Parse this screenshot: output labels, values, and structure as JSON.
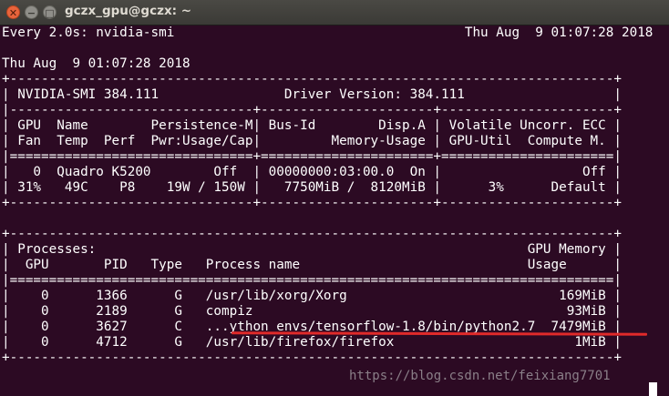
{
  "window": {
    "title": "gczx_gpu@gczx: ~",
    "close_glyph": "✕",
    "minimize_glyph": "−",
    "maximize_glyph": "□"
  },
  "terminal": {
    "lines": [
      "Every 2.0s: nvidia-smi                                     Thu Aug  9 01:07:28 2018",
      "",
      "Thu Aug  9 01:07:28 2018",
      "+-----------------------------------------------------------------------------+",
      "| NVIDIA-SMI 384.111                Driver Version: 384.111                   |",
      "|-------------------------------+----------------------+----------------------+",
      "| GPU  Name        Persistence-M| Bus-Id        Disp.A | Volatile Uncorr. ECC |",
      "| Fan  Temp  Perf  Pwr:Usage/Cap|         Memory-Usage | GPU-Util  Compute M. |",
      "|===============================+======================+======================|",
      "|   0  Quadro K5200        Off  | 00000000:03:00.0  On |                  Off |",
      "| 31%   49C    P8    19W / 150W |   7750MiB /  8120MiB |      3%      Default |",
      "+-------------------------------+----------------------+----------------------+",
      "",
      "+-----------------------------------------------------------------------------+",
      "| Processes:                                                       GPU Memory |",
      "|  GPU       PID   Type   Process name                             Usage      |",
      "|=============================================================================|",
      "|    0      1366      G   /usr/lib/xorg/Xorg                           169MiB |",
      "|    0      2189      G   compiz                                        93MiB |",
      "|    0      3627      C   ...ython_envs/tensorflow-1.8/bin/python2.7  7479MiB |",
      "|    0      4712      G   /usr/lib/firefox/firefox                       1MiB |",
      "+-----------------------------------------------------------------------------+"
    ]
  },
  "annotation": {
    "underline_color": "#e02a2a"
  },
  "watermark": "https://blog.csdn.net/feixiang7701"
}
